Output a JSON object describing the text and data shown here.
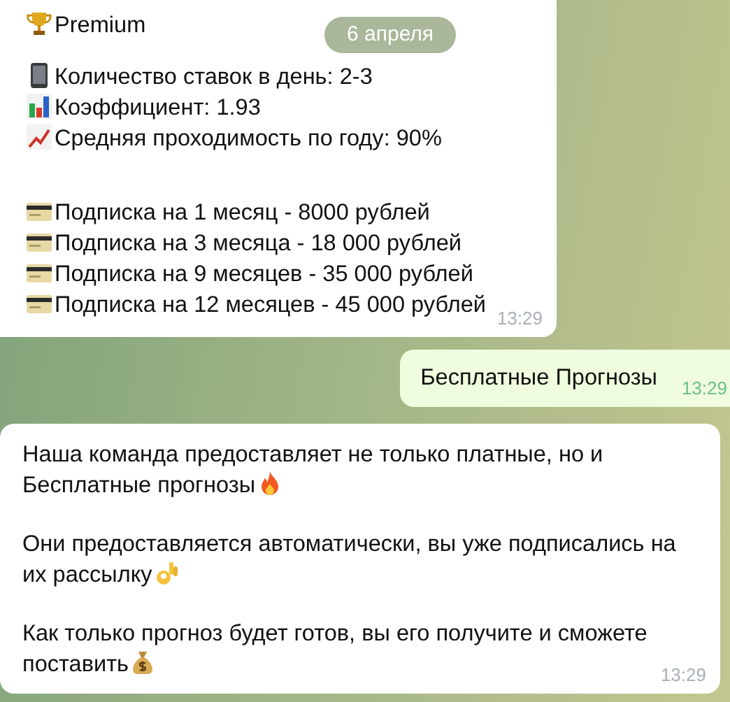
{
  "date_badge": "6 апреля",
  "messages": [
    {
      "kind": "incoming",
      "time": "13:29",
      "paragraphs": [
        [
          {
            "kind": "trophy",
            "text": "Premium"
          }
        ],
        [
          {
            "kind": "phone",
            "text": "Количество ставок в день: 2-3"
          },
          {
            "kind": "bars",
            "text": "Коэффициент: 1.93"
          },
          {
            "kind": "trend",
            "text": "Средняя проходимость по году: 90%"
          }
        ],
        [
          {
            "kind": "card",
            "text": "Подписка на 1 месяц - 8000 рублей"
          },
          {
            "kind": "card",
            "text": "Подписка на 3 месяца - 18 000 рублей"
          },
          {
            "kind": "card",
            "text": "Подписка на 9 месяцев - 35 000 рублей"
          },
          {
            "kind": "card",
            "text": "Подписка на 12 месяцев - 45 000 рублей"
          }
        ]
      ]
    },
    {
      "kind": "outgoing",
      "time": "13:29",
      "paragraphs": [
        [
          {
            "kind": "plain",
            "text": "Бесплатные Прогнозы"
          }
        ]
      ]
    },
    {
      "kind": "incoming",
      "time": "13:29",
      "paragraphs": [
        [
          {
            "kind": "plain",
            "text": "Наша команда предоставляет не только платные, но и"
          },
          {
            "kind": "fire",
            "text": "Бесплатные прогнозы"
          }
        ],
        [
          {
            "kind": "plain",
            "text": "Они предоставляется автоматически, вы уже подписались на"
          },
          {
            "kind": "ok",
            "text": "их рассылку"
          }
        ],
        [
          {
            "kind": "plain",
            "text": "Как только прогноз будет готов, вы его получите и сможете"
          },
          {
            "kind": "money",
            "text": "поставить"
          }
        ]
      ]
    }
  ]
}
